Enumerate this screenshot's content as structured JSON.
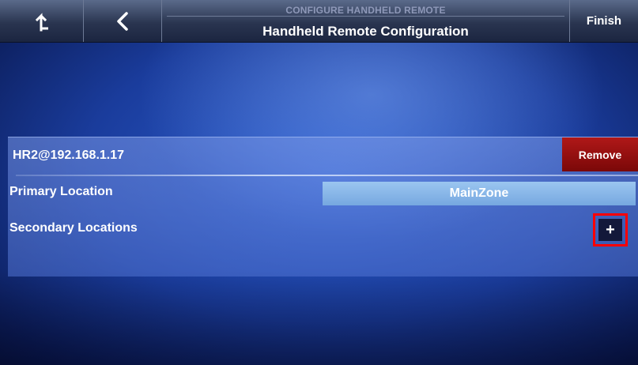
{
  "header": {
    "home_icon": "up-arrow-icon",
    "back_icon": "chevron-left-icon",
    "subtitle": "CONFIGURE HANDHELD REMOTE",
    "title": "Handheld Remote Configuration",
    "finish_label": "Finish"
  },
  "remote": {
    "device_name": "HR2@192.168.1.17",
    "remove_label": "Remove",
    "primary_location_label": "Primary Location",
    "primary_location_value": "MainZone",
    "secondary_locations_label": "Secondary Locations",
    "add_icon": "plus-icon",
    "add_label": "+"
  },
  "colors": {
    "remove_button": "#9a1010",
    "highlight_outline": "#ff0000",
    "primary_value_bg": "#8ab8ea"
  }
}
